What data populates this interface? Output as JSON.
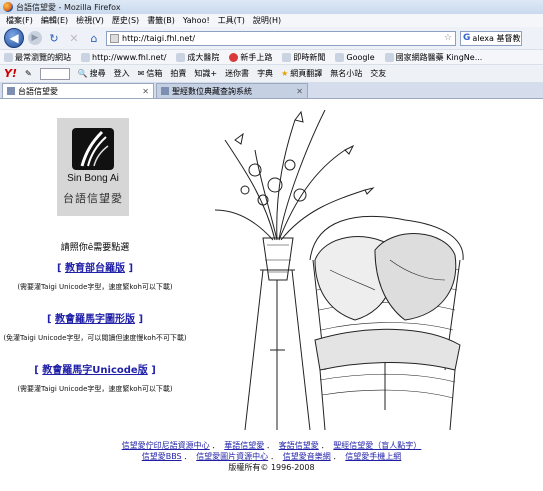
{
  "window": {
    "title": "台語信望愛 - Mozilla Firefox"
  },
  "menu": [
    "檔案(F)",
    "編輯(E)",
    "檢視(V)",
    "歷史(S)",
    "書籤(B)",
    "Yahoo!",
    "工具(T)",
    "說明(H)"
  ],
  "nav": {
    "url": "http://taigi.fhl.net/",
    "search_value": "alexa 基督教"
  },
  "bookmarks": [
    "最常瀏覽的網站",
    "http://www.fhl.net/",
    "成大醫院",
    "新手上路",
    "即時新聞",
    "Google",
    "國家網路醫藥 KingNe..."
  ],
  "yahoo_toolbar": [
    "搜尋",
    "登入",
    "信箱",
    "拍賣",
    "知識+",
    "迷你書",
    "字典",
    "網頁翻譯",
    "無名小站",
    "交友"
  ],
  "tabs": [
    {
      "label": "台語信望愛"
    },
    {
      "label": "聖經數位典藏查詢系統"
    }
  ],
  "logo": {
    "name": "Sin Bong Ai",
    "chinese": "台語信望愛"
  },
  "main": {
    "prompt": "請照你ê需要點選",
    "options": [
      {
        "label": "教育部台羅版",
        "note": "(需要灌Taigi Unicode字型，速度緊koh可以下載)"
      },
      {
        "label": "教會羅馬字圖形版",
        "note": "(免灌Taigi Unicode字型，可以閱讀但速度慢koh不可下載)"
      },
      {
        "label": "教會羅馬字Unicode版",
        "note": "(需要灌Taigi Unicode字型，速度緊koh可以下載)"
      }
    ]
  },
  "footer": {
    "row1": [
      "信望愛佇印尼語資源中心",
      "華語信望愛",
      "客語信望愛",
      "聖經信望愛（盲人點字）"
    ],
    "row2": [
      "信望愛BBS",
      "信望愛圖片資源中心",
      "信望愛音樂網",
      "信望愛手機上網"
    ],
    "copyright": "版權所有© 1996-2008"
  },
  "colors": {
    "link": "#1f1fa8",
    "logo_bg": "#d6d6d6"
  }
}
